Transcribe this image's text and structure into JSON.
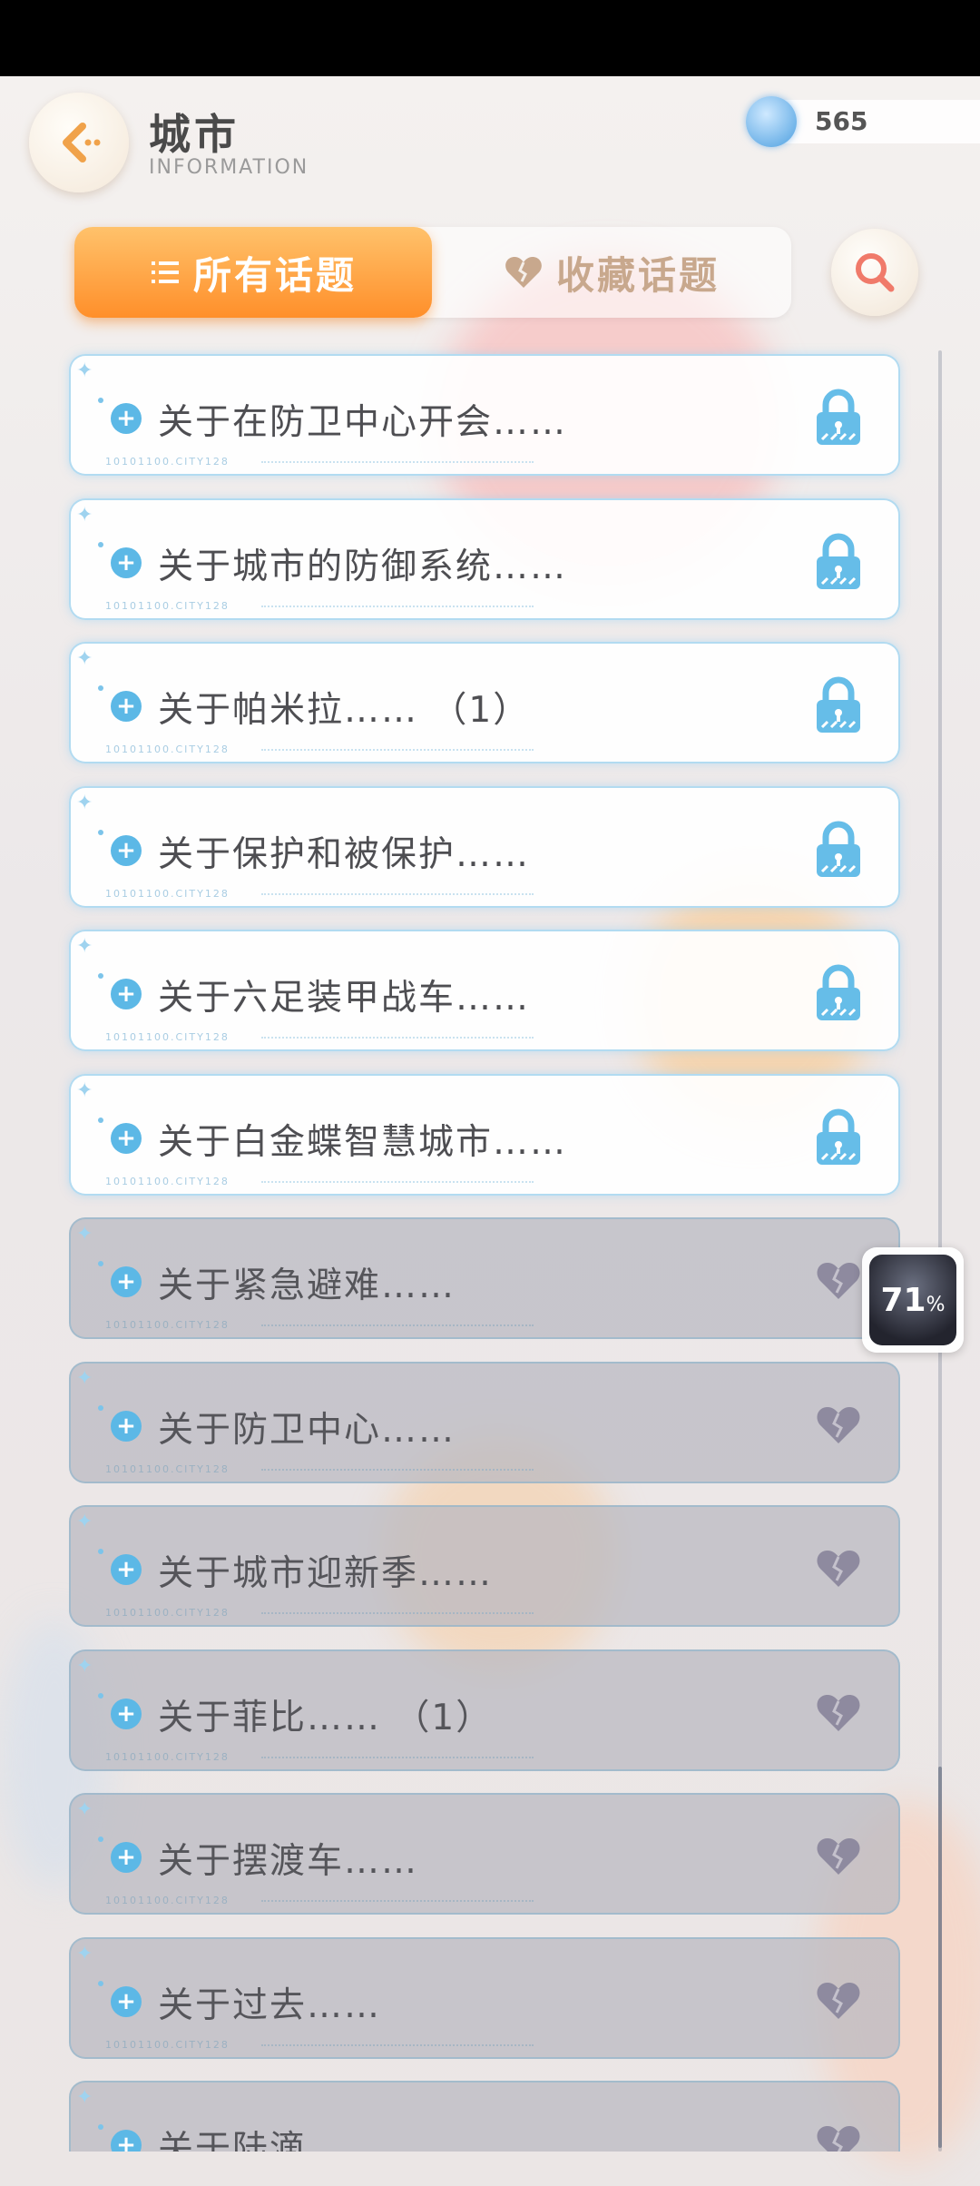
{
  "header": {
    "title": "城市",
    "subtitle": "INFORMATION",
    "currency_value": "565"
  },
  "tabs": {
    "all_label": "所有话题",
    "favorites_label": "收藏话题"
  },
  "topics": [
    {
      "label": "关于在防卫中心开会……",
      "locked": false
    },
    {
      "label": "关于城市的防御系统……",
      "locked": false
    },
    {
      "label": "关于帕米拉…… （1）",
      "locked": false
    },
    {
      "label": "关于保护和被保护……",
      "locked": false
    },
    {
      "label": "关于六足装甲战车……",
      "locked": false
    },
    {
      "label": "关于白金蝶智慧城市……",
      "locked": false
    },
    {
      "label": "关于紧急避难……",
      "locked": true
    },
    {
      "label": "关于防卫中心……",
      "locked": true
    },
    {
      "label": "关于城市迎新季……",
      "locked": true
    },
    {
      "label": "关于菲比…… （1）",
      "locked": true
    },
    {
      "label": "关于摆渡车……",
      "locked": true
    },
    {
      "label": "关于过去……",
      "locked": true
    },
    {
      "label": "关于陆滴……",
      "locked": true
    }
  ],
  "item_code_text": "10101100.CITY128",
  "floating_widget": {
    "value": "71",
    "unit": "%"
  }
}
